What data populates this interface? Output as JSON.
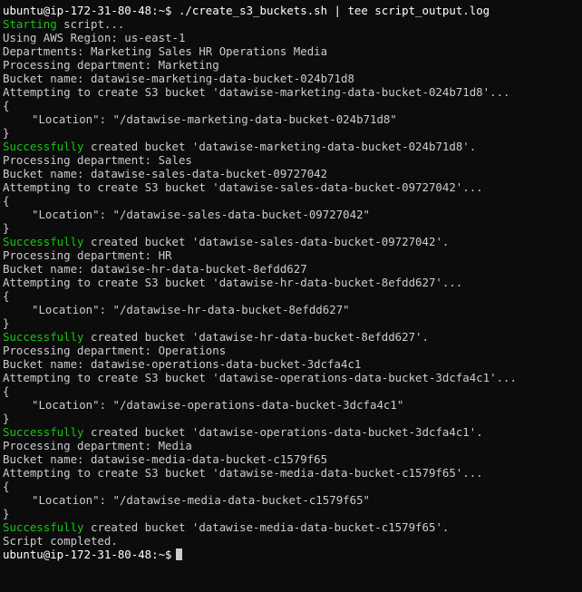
{
  "terminal": {
    "prompt": "ubuntu@ip-172-31-80-48:~$",
    "command": "./create_s3_buckets.sh | tee script_output.log",
    "success_word": "Successfully",
    "lines": {
      "starting_word": "Starting",
      "starting_rest": " script...",
      "region": "Using AWS Region: us-east-1",
      "departments": "Departments: Marketing Sales HR Operations Media",
      "brace_open": "{",
      "brace_close": "}",
      "completed": "Script completed."
    },
    "departments": [
      {
        "processing": "Processing department: Marketing",
        "bucket_name": "Bucket name: datawise-marketing-data-bucket-024b71d8",
        "attempting": "Attempting to create S3 bucket 'datawise-marketing-data-bucket-024b71d8'...",
        "location": "\"Location\": \"/datawise-marketing-data-bucket-024b71d8\"",
        "created": " created bucket 'datawise-marketing-data-bucket-024b71d8'."
      },
      {
        "processing": "Processing department: Sales",
        "bucket_name": "Bucket name: datawise-sales-data-bucket-09727042",
        "attempting": "Attempting to create S3 bucket 'datawise-sales-data-bucket-09727042'...",
        "location": "\"Location\": \"/datawise-sales-data-bucket-09727042\"",
        "created": " created bucket 'datawise-sales-data-bucket-09727042'."
      },
      {
        "processing": "Processing department: HR",
        "bucket_name": "Bucket name: datawise-hr-data-bucket-8efdd627",
        "attempting": "Attempting to create S3 bucket 'datawise-hr-data-bucket-8efdd627'...",
        "location": "\"Location\": \"/datawise-hr-data-bucket-8efdd627\"",
        "created": " created bucket 'datawise-hr-data-bucket-8efdd627'."
      },
      {
        "processing": "Processing department: Operations",
        "bucket_name": "Bucket name: datawise-operations-data-bucket-3dcfa4c1",
        "attempting": "Attempting to create S3 bucket 'datawise-operations-data-bucket-3dcfa4c1'...",
        "location": "\"Location\": \"/datawise-operations-data-bucket-3dcfa4c1\"",
        "created": " created bucket 'datawise-operations-data-bucket-3dcfa4c1'."
      },
      {
        "processing": "Processing department: Media",
        "bucket_name": "Bucket name: datawise-media-data-bucket-c1579f65",
        "attempting": "Attempting to create S3 bucket 'datawise-media-data-bucket-c1579f65'...",
        "location": "\"Location\": \"/datawise-media-data-bucket-c1579f65\"",
        "created": " created bucket 'datawise-media-data-bucket-c1579f65'."
      }
    ]
  },
  "colors": {
    "background": "#0c0c0c",
    "text": "#cccccc",
    "success": "#16c60c"
  }
}
